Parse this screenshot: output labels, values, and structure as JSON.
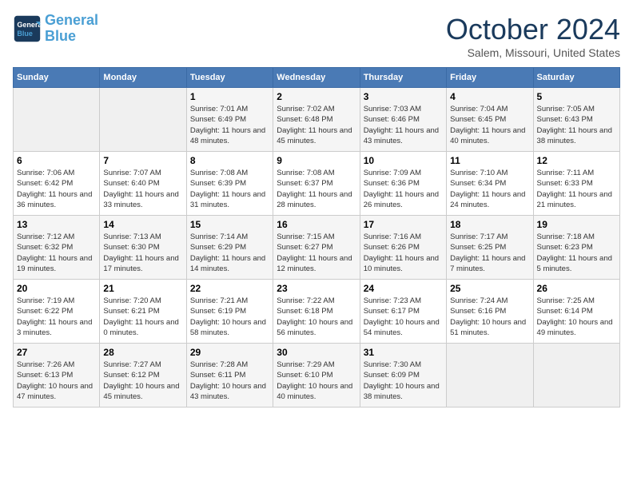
{
  "header": {
    "logo_line1": "General",
    "logo_line2": "Blue",
    "month": "October 2024",
    "location": "Salem, Missouri, United States"
  },
  "weekdays": [
    "Sunday",
    "Monday",
    "Tuesday",
    "Wednesday",
    "Thursday",
    "Friday",
    "Saturday"
  ],
  "weeks": [
    [
      {
        "day": "",
        "info": ""
      },
      {
        "day": "",
        "info": ""
      },
      {
        "day": "1",
        "info": "Sunrise: 7:01 AM\nSunset: 6:49 PM\nDaylight: 11 hours and 48 minutes."
      },
      {
        "day": "2",
        "info": "Sunrise: 7:02 AM\nSunset: 6:48 PM\nDaylight: 11 hours and 45 minutes."
      },
      {
        "day": "3",
        "info": "Sunrise: 7:03 AM\nSunset: 6:46 PM\nDaylight: 11 hours and 43 minutes."
      },
      {
        "day": "4",
        "info": "Sunrise: 7:04 AM\nSunset: 6:45 PM\nDaylight: 11 hours and 40 minutes."
      },
      {
        "day": "5",
        "info": "Sunrise: 7:05 AM\nSunset: 6:43 PM\nDaylight: 11 hours and 38 minutes."
      }
    ],
    [
      {
        "day": "6",
        "info": "Sunrise: 7:06 AM\nSunset: 6:42 PM\nDaylight: 11 hours and 36 minutes."
      },
      {
        "day": "7",
        "info": "Sunrise: 7:07 AM\nSunset: 6:40 PM\nDaylight: 11 hours and 33 minutes."
      },
      {
        "day": "8",
        "info": "Sunrise: 7:08 AM\nSunset: 6:39 PM\nDaylight: 11 hours and 31 minutes."
      },
      {
        "day": "9",
        "info": "Sunrise: 7:08 AM\nSunset: 6:37 PM\nDaylight: 11 hours and 28 minutes."
      },
      {
        "day": "10",
        "info": "Sunrise: 7:09 AM\nSunset: 6:36 PM\nDaylight: 11 hours and 26 minutes."
      },
      {
        "day": "11",
        "info": "Sunrise: 7:10 AM\nSunset: 6:34 PM\nDaylight: 11 hours and 24 minutes."
      },
      {
        "day": "12",
        "info": "Sunrise: 7:11 AM\nSunset: 6:33 PM\nDaylight: 11 hours and 21 minutes."
      }
    ],
    [
      {
        "day": "13",
        "info": "Sunrise: 7:12 AM\nSunset: 6:32 PM\nDaylight: 11 hours and 19 minutes."
      },
      {
        "day": "14",
        "info": "Sunrise: 7:13 AM\nSunset: 6:30 PM\nDaylight: 11 hours and 17 minutes."
      },
      {
        "day": "15",
        "info": "Sunrise: 7:14 AM\nSunset: 6:29 PM\nDaylight: 11 hours and 14 minutes."
      },
      {
        "day": "16",
        "info": "Sunrise: 7:15 AM\nSunset: 6:27 PM\nDaylight: 11 hours and 12 minutes."
      },
      {
        "day": "17",
        "info": "Sunrise: 7:16 AM\nSunset: 6:26 PM\nDaylight: 11 hours and 10 minutes."
      },
      {
        "day": "18",
        "info": "Sunrise: 7:17 AM\nSunset: 6:25 PM\nDaylight: 11 hours and 7 minutes."
      },
      {
        "day": "19",
        "info": "Sunrise: 7:18 AM\nSunset: 6:23 PM\nDaylight: 11 hours and 5 minutes."
      }
    ],
    [
      {
        "day": "20",
        "info": "Sunrise: 7:19 AM\nSunset: 6:22 PM\nDaylight: 11 hours and 3 minutes."
      },
      {
        "day": "21",
        "info": "Sunrise: 7:20 AM\nSunset: 6:21 PM\nDaylight: 11 hours and 0 minutes."
      },
      {
        "day": "22",
        "info": "Sunrise: 7:21 AM\nSunset: 6:19 PM\nDaylight: 10 hours and 58 minutes."
      },
      {
        "day": "23",
        "info": "Sunrise: 7:22 AM\nSunset: 6:18 PM\nDaylight: 10 hours and 56 minutes."
      },
      {
        "day": "24",
        "info": "Sunrise: 7:23 AM\nSunset: 6:17 PM\nDaylight: 10 hours and 54 minutes."
      },
      {
        "day": "25",
        "info": "Sunrise: 7:24 AM\nSunset: 6:16 PM\nDaylight: 10 hours and 51 minutes."
      },
      {
        "day": "26",
        "info": "Sunrise: 7:25 AM\nSunset: 6:14 PM\nDaylight: 10 hours and 49 minutes."
      }
    ],
    [
      {
        "day": "27",
        "info": "Sunrise: 7:26 AM\nSunset: 6:13 PM\nDaylight: 10 hours and 47 minutes."
      },
      {
        "day": "28",
        "info": "Sunrise: 7:27 AM\nSunset: 6:12 PM\nDaylight: 10 hours and 45 minutes."
      },
      {
        "day": "29",
        "info": "Sunrise: 7:28 AM\nSunset: 6:11 PM\nDaylight: 10 hours and 43 minutes."
      },
      {
        "day": "30",
        "info": "Sunrise: 7:29 AM\nSunset: 6:10 PM\nDaylight: 10 hours and 40 minutes."
      },
      {
        "day": "31",
        "info": "Sunrise: 7:30 AM\nSunset: 6:09 PM\nDaylight: 10 hours and 38 minutes."
      },
      {
        "day": "",
        "info": ""
      },
      {
        "day": "",
        "info": ""
      }
    ]
  ]
}
